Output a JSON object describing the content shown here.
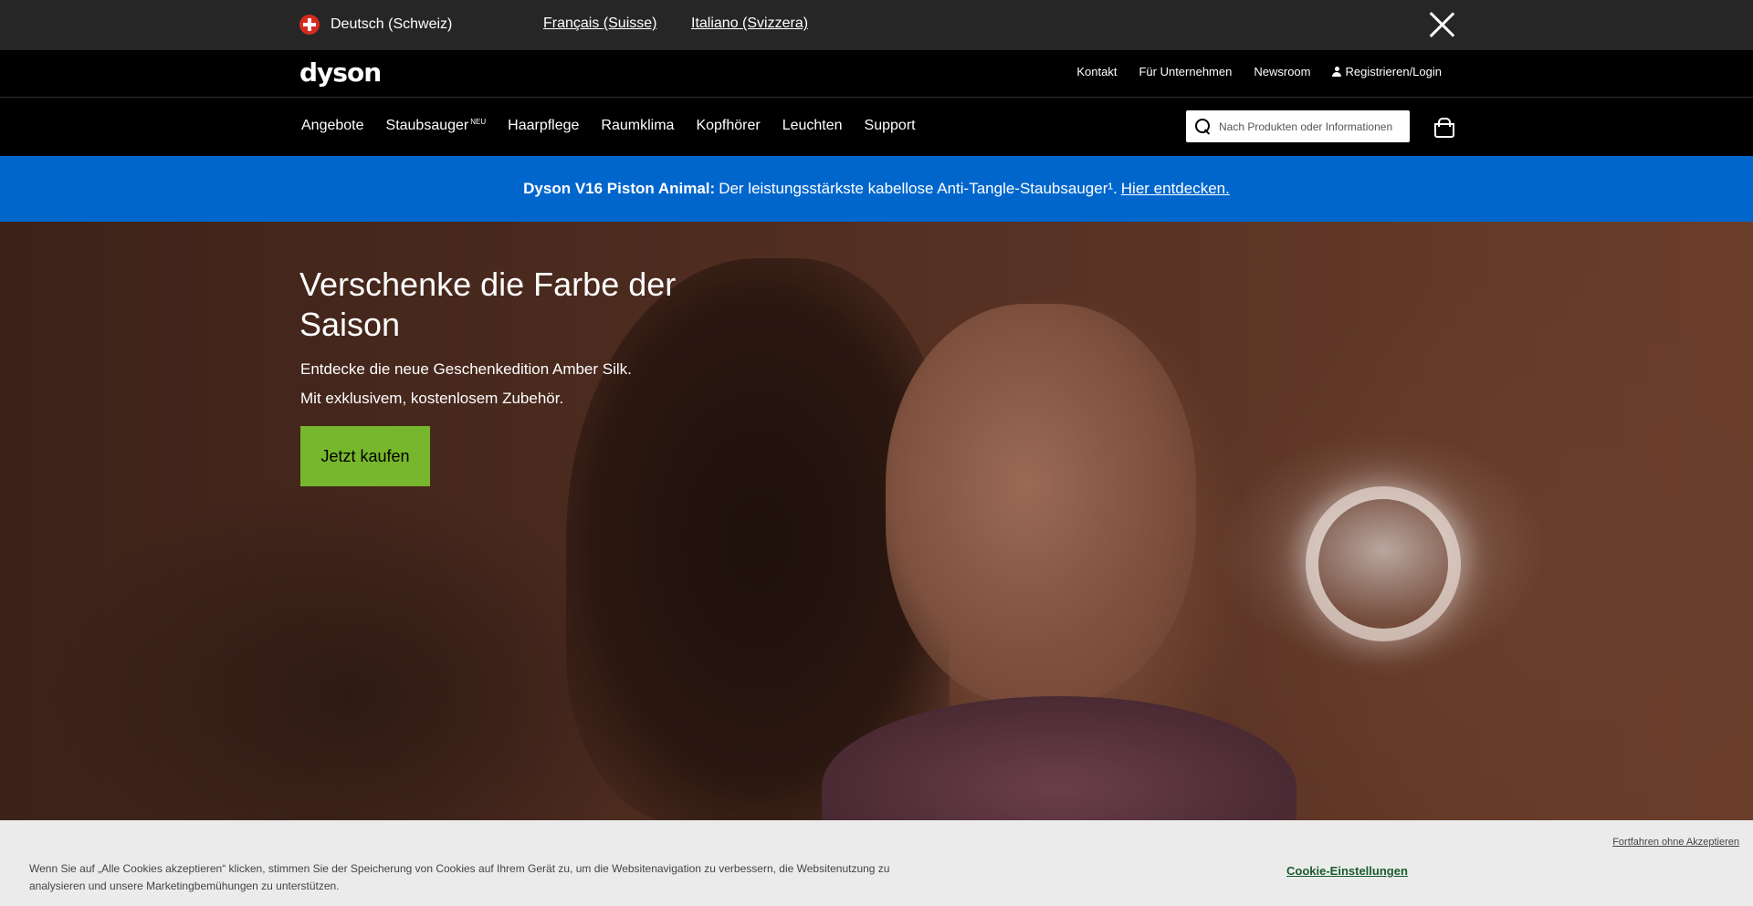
{
  "language_bar": {
    "current": "Deutsch (Schweiz)",
    "alternatives": [
      "Français (Suisse)",
      "Italiano (Svizzera)"
    ],
    "flag_icon": "swiss-flag-icon",
    "close_icon": "close-icon"
  },
  "utility_bar": {
    "logo": "dyson",
    "links": [
      "Kontakt",
      "Für Unternehmen",
      "Newsroom",
      "Registrieren/Login"
    ]
  },
  "main_nav": {
    "items": [
      {
        "label": "Angebote",
        "badge": ""
      },
      {
        "label": "Staubsauger",
        "badge": "NEU"
      },
      {
        "label": "Haarpflege",
        "badge": ""
      },
      {
        "label": "Raumklima",
        "badge": ""
      },
      {
        "label": "Kopfhörer",
        "badge": ""
      },
      {
        "label": "Leuchten",
        "badge": ""
      },
      {
        "label": "Support",
        "badge": ""
      }
    ],
    "search_placeholder": "Nach Produkten oder Informationen",
    "basket_icon": "basket-icon"
  },
  "promo_bar": {
    "product": "Dyson V16 Piston Animal:",
    "text": "Der leistungsstärkste kabellose Anti-Tangle-Staubsauger¹.",
    "link": "Hier entdecken.",
    "background": "#0066cc"
  },
  "hero": {
    "title": "Verschenke die Farbe der Saison",
    "subtitle_line1": "Entdecke die neue Geschenkedition Amber Silk.",
    "subtitle_line2": "Mit exklusivem, kostenlosem Zubehör.",
    "cta": "Jetzt kaufen",
    "cta_color": "#77b72d"
  },
  "cookie_bar": {
    "text": "Wenn Sie auf „Alle Cookies akzeptieren“ klicken, stimmen Sie der Speicherung von Cookies auf Ihrem Gerät zu, um die Websitenavigation zu verbessern, die Websitenutzung zu analysieren und unsere Marketingbemühungen zu unterstützen.",
    "skip": "Fortfahren ohne Akzeptieren",
    "settings": "Cookie-Einstellungen"
  }
}
